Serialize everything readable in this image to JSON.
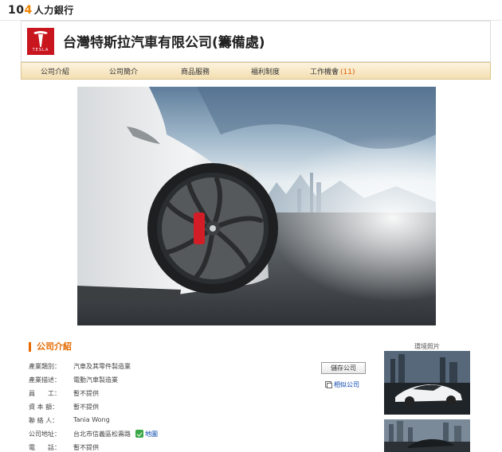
{
  "site": {
    "logo_num": "10",
    "logo_four": "4",
    "logo_text": "人力銀行"
  },
  "company": {
    "name": "台灣特斯拉汽車有限公司(籌備處)",
    "brand_word": "TESLA"
  },
  "nav": [
    {
      "label": "公司介紹"
    },
    {
      "label": "公司簡介"
    },
    {
      "label": "商品服務"
    },
    {
      "label": "福利制度"
    },
    {
      "label": "工作機會",
      "count": "(11)"
    }
  ],
  "section": {
    "title": "公司介紹"
  },
  "info": [
    {
      "label": "產業類別：",
      "value": "汽車及其零件製造業"
    },
    {
      "label": "產業描述：",
      "value": "電動汽車製造業"
    },
    {
      "label": "員　　工：",
      "value": "暫不提供"
    },
    {
      "label": "資 本 額：",
      "value": "暫不提供"
    },
    {
      "label": "聯 絡 人：",
      "value": "Tania Wong"
    },
    {
      "label": "公司地址：",
      "value": "台北市信義區松壽路",
      "map_label": "地圖"
    },
    {
      "label": "電　　話：",
      "value": "暫不提供"
    }
  ],
  "actions": {
    "save": "儲存公司",
    "similar": "相似公司"
  },
  "env": {
    "title": "環境照片"
  },
  "colors": {
    "accent": "#e56a00",
    "brand": "#c8151e",
    "link": "#0645ad"
  }
}
